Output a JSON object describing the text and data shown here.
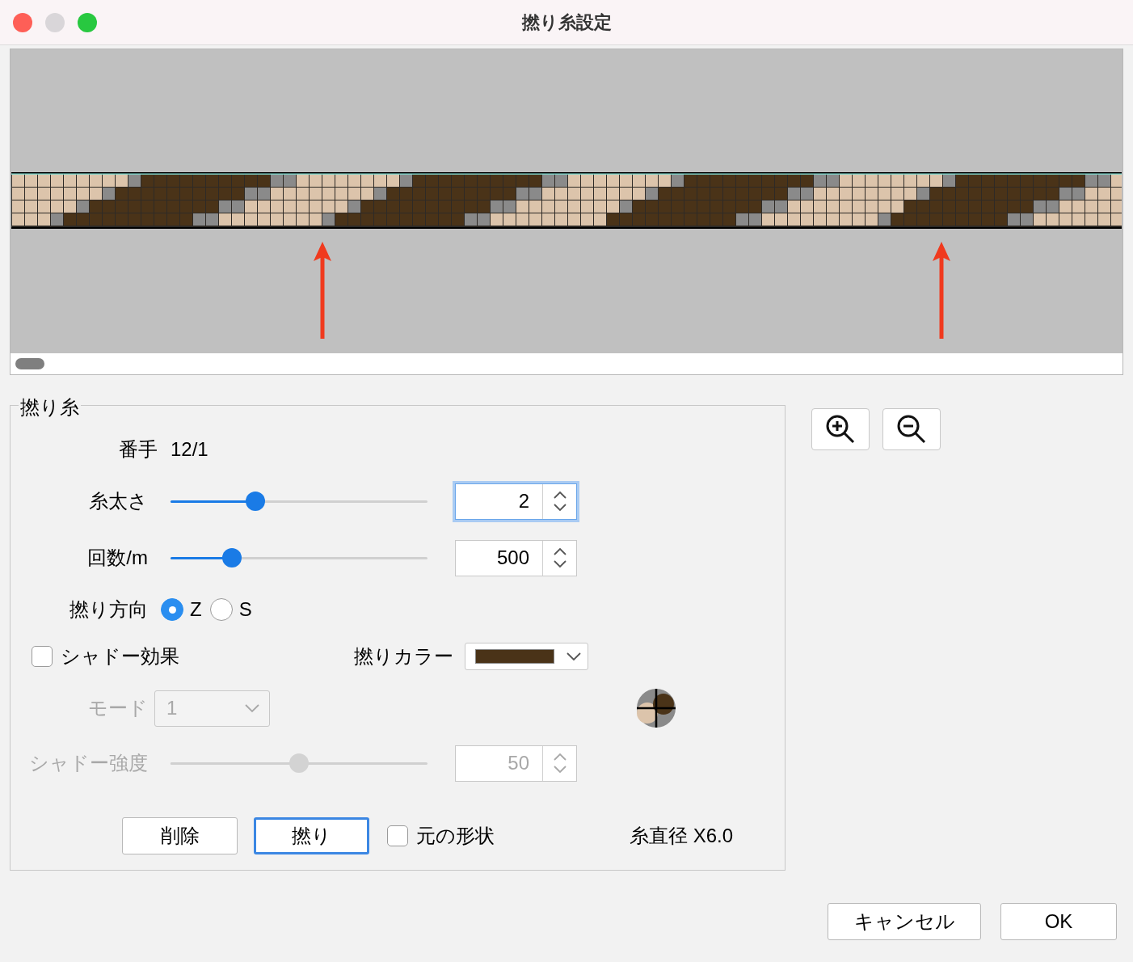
{
  "window": {
    "title": "撚り糸設定"
  },
  "group": {
    "title": "撚り糸"
  },
  "count": {
    "label": "番手",
    "value": "12/1"
  },
  "thickness": {
    "label": "糸太さ",
    "level": 0.33,
    "value": "2",
    "focused": true
  },
  "twists": {
    "label": "回数/m",
    "level": 0.24,
    "value": "500",
    "focused": false
  },
  "direction": {
    "label": "撚り方向",
    "options": [
      {
        "label": "Z",
        "selected": true
      },
      {
        "label": "S",
        "selected": false
      }
    ]
  },
  "shadow": {
    "label": "シャドー効果",
    "checked": false
  },
  "twist_color": {
    "label": "撚りカラー",
    "color": "#4a3318"
  },
  "mode": {
    "label": "モード",
    "value": "1",
    "disabled": true
  },
  "shadow_strength": {
    "label": "シャドー強度",
    "level": 0.5,
    "value": "50",
    "disabled": true
  },
  "actions": [
    {
      "label": "削除",
      "default": false
    },
    {
      "label": "撚り",
      "default": true
    }
  ],
  "original_shape": {
    "label": "元の形状",
    "checked": false
  },
  "diameter": "糸直径 X6.0",
  "footer_buttons": [
    {
      "label": "キャンセル"
    },
    {
      "label": "OK"
    }
  ]
}
